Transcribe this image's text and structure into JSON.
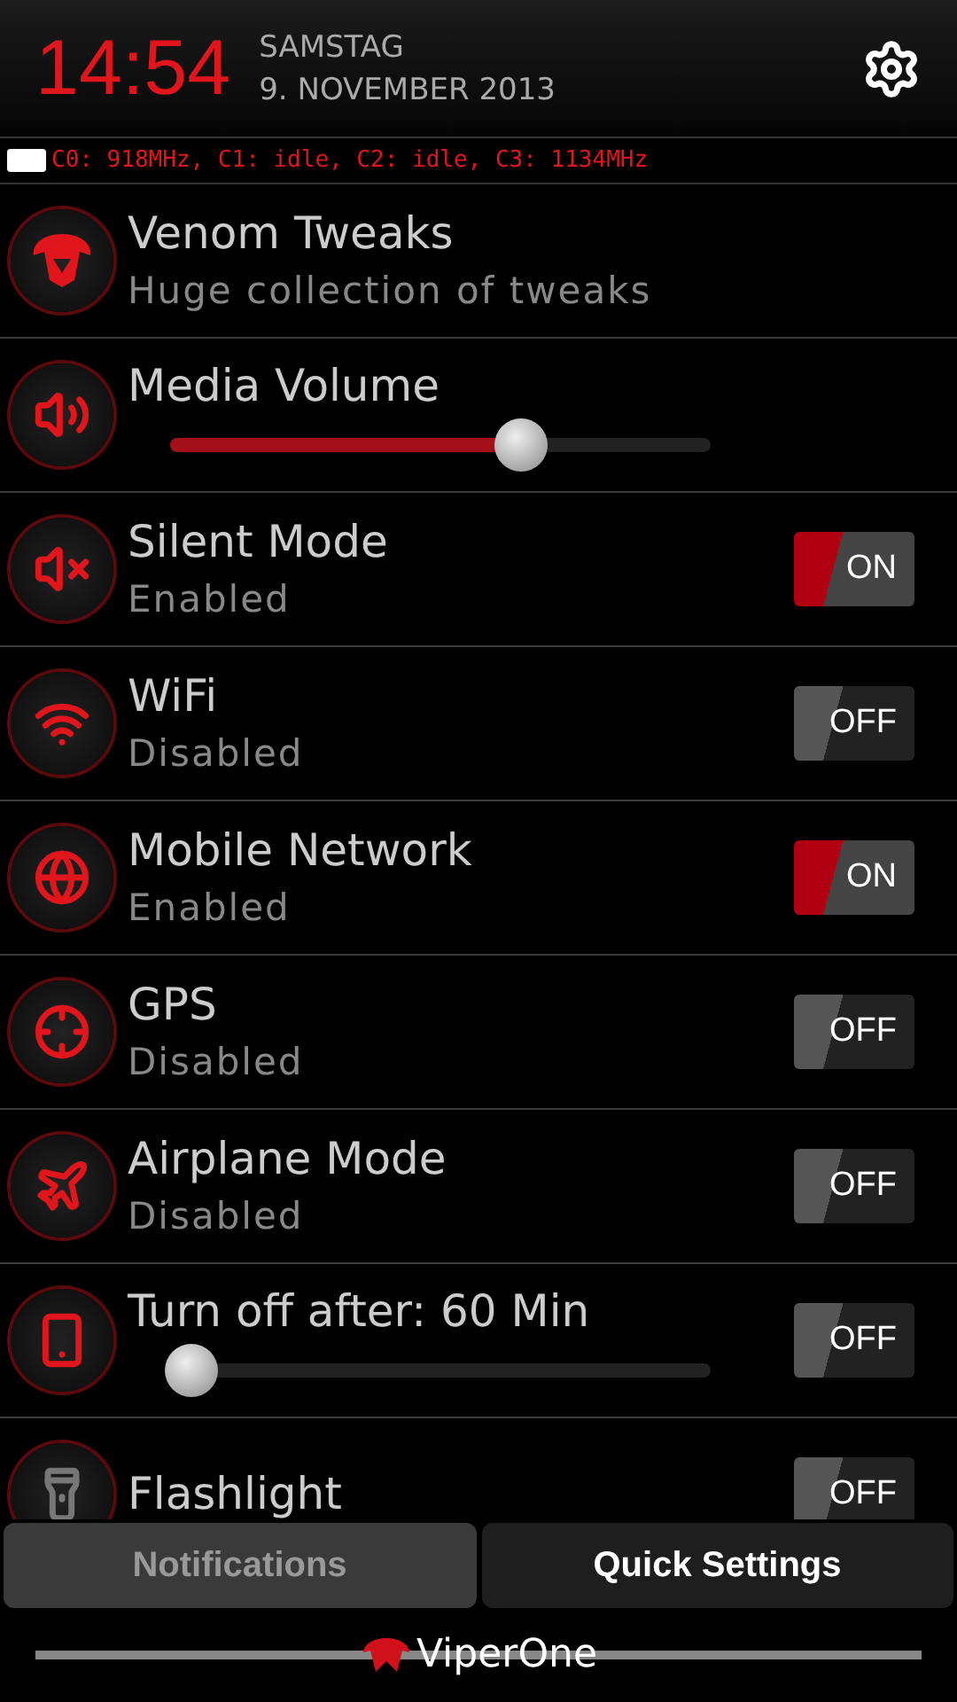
{
  "header": {
    "time": "14:54",
    "weekday": "SAMSTAG",
    "date": "9. NOVEMBER 2013"
  },
  "cpu_status": "C0: 918MHz, C1: idle, C2: idle, C3: 1134MHz",
  "rows": [
    {
      "kind": "link",
      "title": "Venom Tweaks",
      "subtitle": "Huge collection of tweaks"
    },
    {
      "kind": "slider",
      "title": "Media Volume",
      "level": 0.65
    },
    {
      "kind": "toggle",
      "title": "Silent Mode",
      "subtitle": "Enabled",
      "on": true,
      "toggle_label": "ON"
    },
    {
      "kind": "toggle",
      "title": "WiFi",
      "subtitle": "Disabled",
      "on": false,
      "toggle_label": "OFF"
    },
    {
      "kind": "toggle",
      "title": "Mobile Network",
      "subtitle": "Enabled",
      "on": true,
      "toggle_label": "ON"
    },
    {
      "kind": "toggle",
      "title": "GPS",
      "subtitle": "Disabled",
      "on": false,
      "toggle_label": "OFF"
    },
    {
      "kind": "toggle",
      "title": "Airplane Mode",
      "subtitle": "Disabled",
      "on": false,
      "toggle_label": "OFF"
    },
    {
      "kind": "slider_toggle",
      "title": "Turn off after: 60 Min",
      "level": 0.04,
      "on": false,
      "toggle_label": "OFF"
    },
    {
      "kind": "toggle",
      "title": "Flashlight",
      "on": false,
      "toggle_label": "OFF"
    }
  ],
  "tabs": [
    {
      "label": "Notifications",
      "selected": false
    },
    {
      "label": "Quick Settings",
      "selected": true
    }
  ],
  "footer": {
    "brand": "ViperOne"
  }
}
